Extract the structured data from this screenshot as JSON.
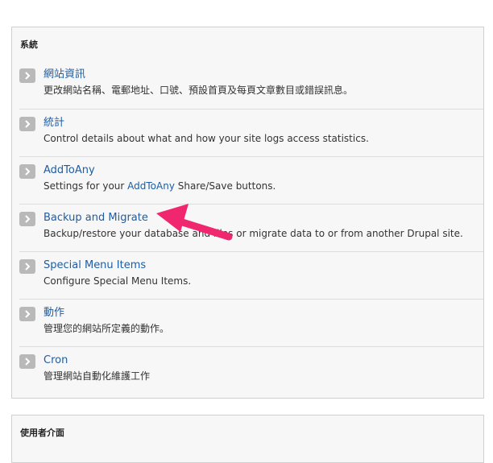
{
  "system": {
    "title": "系統",
    "items": [
      {
        "title": "網站資訊",
        "description": "更改網站名稱、電郵地址、口號、預設首頁及每頁文章數目或錯誤訊息。"
      },
      {
        "title": "統計",
        "description": "Control details about what and how your site logs access statistics."
      },
      {
        "title": "AddToAny",
        "description_prefix": "Settings for your ",
        "description_link": "AddToAny",
        "description_suffix": " Share/Save buttons."
      },
      {
        "title": "Backup and Migrate",
        "description": "Backup/restore your database and files or migrate data to or from another Drupal site."
      },
      {
        "title": "Special Menu Items",
        "description": "Configure Special Menu Items."
      },
      {
        "title": "動作",
        "description": "管理您的網站所定義的動作。"
      },
      {
        "title": "Cron",
        "description": "管理網站自動化維護工作"
      }
    ]
  },
  "user_interface": {
    "title": "使用者介面"
  },
  "annotation": {
    "arrow_color": "#f0266e",
    "icon": "arrow-icon"
  },
  "colors": {
    "link": "#1d5da5",
    "chevron_bg": "#b9b9b9",
    "panel_bg": "#f7f7f7"
  }
}
